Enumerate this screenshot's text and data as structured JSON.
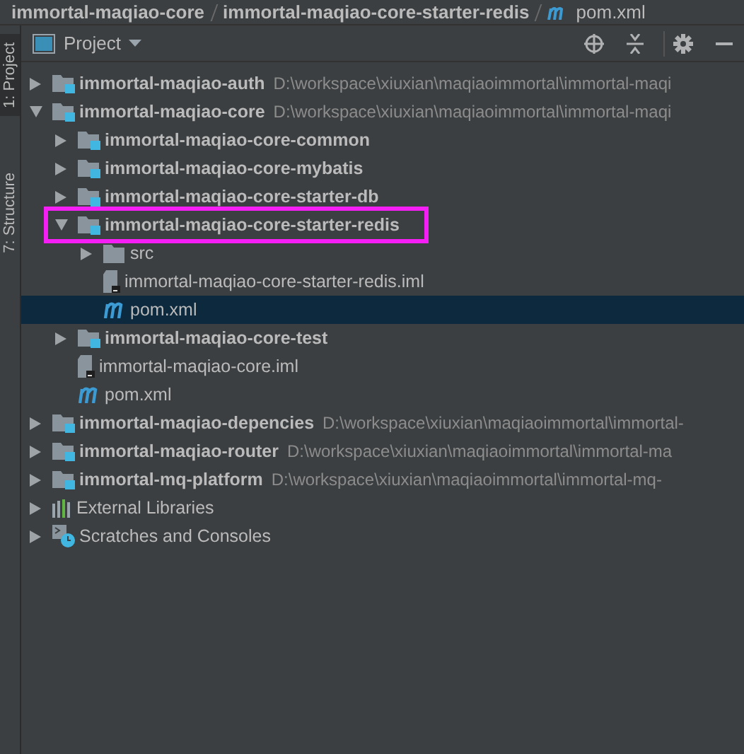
{
  "breadcrumb": [
    {
      "kind": "module",
      "label": "immortal-maqiao-core"
    },
    {
      "kind": "module",
      "label": "immortal-maqiao-core-starter-redis"
    },
    {
      "kind": "maven",
      "label": "pom.xml"
    }
  ],
  "side_tabs": [
    {
      "label": "1: Project",
      "selected": true
    },
    {
      "label": "7: Structure",
      "selected": false
    }
  ],
  "panel": {
    "title": "Project"
  },
  "tree": [
    {
      "kind": "module",
      "label": "immortal-maqiao-auth",
      "path": "D:\\workspace\\xiuxian\\maqiaoimmortal\\immortal-maqi",
      "expanded": false,
      "selected": false
    },
    {
      "kind": "module",
      "label": "immortal-maqiao-core",
      "path": "D:\\workspace\\xiuxian\\maqiaoimmortal\\immortal-maqi",
      "expanded": true,
      "selected": false,
      "children": [
        {
          "kind": "module",
          "label": "immortal-maqiao-core-common",
          "expanded": false,
          "selected": false
        },
        {
          "kind": "module",
          "label": "immortal-maqiao-core-mybatis",
          "expanded": false,
          "selected": false
        },
        {
          "kind": "module",
          "label": "immortal-maqiao-core-starter-db",
          "expanded": false,
          "selected": false
        },
        {
          "kind": "module",
          "label": "immortal-maqiao-core-starter-redis",
          "expanded": true,
          "selected": false,
          "highlighted": true,
          "children": [
            {
              "kind": "folder",
              "label": "src",
              "expanded": false,
              "selected": false
            },
            {
              "kind": "iml",
              "label": "immortal-maqiao-core-starter-redis.iml",
              "selected": false
            },
            {
              "kind": "maven",
              "label": "pom.xml",
              "selected": true
            }
          ]
        },
        {
          "kind": "module",
          "label": "immortal-maqiao-core-test",
          "expanded": false,
          "selected": false
        },
        {
          "kind": "iml",
          "label": "immortal-maqiao-core.iml",
          "selected": false
        },
        {
          "kind": "maven",
          "label": "pom.xml",
          "selected": false
        }
      ]
    },
    {
      "kind": "module",
      "label": "immortal-maqiao-depencies",
      "path": "D:\\workspace\\xiuxian\\maqiaoimmortal\\immortal-",
      "expanded": false,
      "selected": false
    },
    {
      "kind": "module",
      "label": "immortal-maqiao-router",
      "path": "D:\\workspace\\xiuxian\\maqiaoimmortal\\immortal-ma",
      "expanded": false,
      "selected": false
    },
    {
      "kind": "module",
      "label": "immortal-mq-platform",
      "path": "D:\\workspace\\xiuxian\\maqiaoimmortal\\immortal-mq-",
      "expanded": false,
      "selected": false
    },
    {
      "kind": "libraries",
      "label": "External Libraries",
      "expanded": false,
      "selected": false
    },
    {
      "kind": "scratches",
      "label": "Scratches and Consoles",
      "expanded": false,
      "selected": false
    }
  ]
}
